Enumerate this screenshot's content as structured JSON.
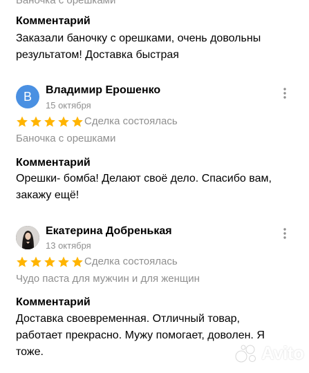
{
  "first_review_tail": {
    "product": "Баночка с орешками",
    "comment_title": "Комментарий",
    "comment_text": "Заказали баночку с орешками, очень довольны результатом! Доставка быстрая"
  },
  "reviews": [
    {
      "author": "Владимир Ерошенко",
      "avatar_letter": "В",
      "avatar_color": "#4a90e2",
      "date": "15 октября",
      "rating": 5,
      "status": "Сделка состоялась",
      "product": "Баночка с орешками",
      "comment_title": "Комментарий",
      "comment_text": "Орешки- бомба! Делают своё дело. Спасибо вам, закажу ещё!"
    },
    {
      "author": "Екатерина Добренькая",
      "avatar_icon": "user-photo-avatar",
      "date": "13 октября",
      "rating": 5,
      "status": "Сделка состоялась",
      "product": "Чудо паста для мужчин и для женщин",
      "comment_title": "Комментарий",
      "comment_text": "Доставка своевременная. Отличный товар, работает прекрасно. Мужу помогает, доволен. Я тоже."
    }
  ],
  "icons": {
    "more": "more-vertical-icon",
    "star": "star-icon"
  },
  "colors": {
    "star": "#ffb400",
    "muted_text": "#8f8f8f"
  },
  "watermark": {
    "text": "Avito",
    "icon": "avito-logo-icon"
  }
}
